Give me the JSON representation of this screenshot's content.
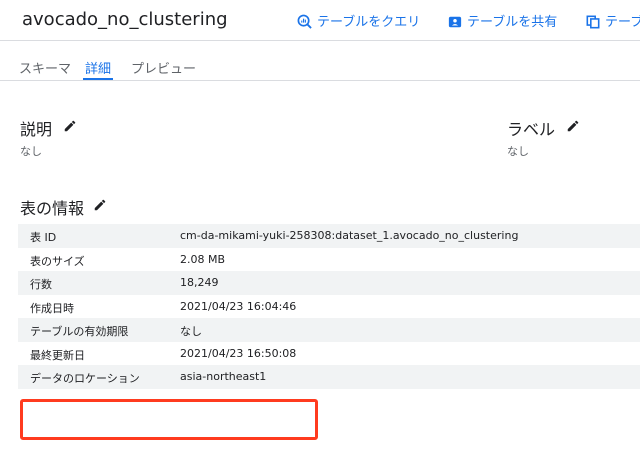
{
  "header": {
    "title": "avocado_no_clustering",
    "actions": [
      {
        "label": "テーブルをクエリ",
        "icon": "query-icon"
      },
      {
        "label": "テーブルを共有",
        "icon": "share-icon"
      },
      {
        "label": "テーブ",
        "icon": "copy-icon"
      }
    ]
  },
  "tabs": [
    "スキーマ",
    "詳細",
    "プレビュー"
  ],
  "active_tab": "詳細",
  "description": {
    "title": "説明",
    "value": "なし"
  },
  "labels": {
    "title": "ラベル",
    "value": "なし"
  },
  "table_info": {
    "title": "表の情報",
    "rows": [
      {
        "key": "表 ID",
        "value": "cm-da-mikami-yuki-258308:dataset_1.avocado_no_clustering"
      },
      {
        "key": "表のサイズ",
        "value": "2.08 MB"
      },
      {
        "key": "行数",
        "value": "18,249"
      },
      {
        "key": "作成日時",
        "value": "2021/04/23 16:04:46"
      },
      {
        "key": "テーブルの有効期限",
        "value": "なし"
      },
      {
        "key": "最終更新日",
        "value": "2021/04/23 16:50:08"
      },
      {
        "key": "データのロケーション",
        "value": "asia-northeast1"
      }
    ]
  },
  "colors": {
    "accent": "#1a73e8",
    "highlight_box": "#ff3b1f",
    "row_shade": "#f1f3f4"
  }
}
